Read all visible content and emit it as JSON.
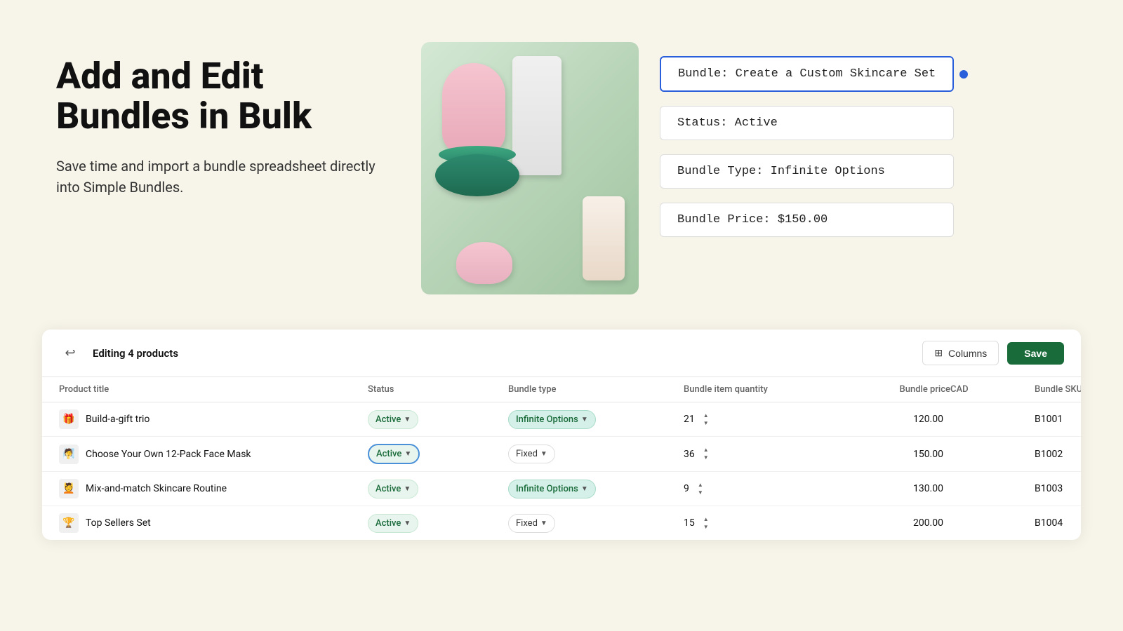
{
  "hero": {
    "title": "Add and Edit Bundles in Bulk",
    "subtitle": "Save time and import a bundle spreadsheet directly into Simple Bundles."
  },
  "info_cards": [
    {
      "id": "bundle-name",
      "label": "Bundle: Create a Custom Skincare Set",
      "highlighted": true
    },
    {
      "id": "status",
      "label": "Status: Active",
      "highlighted": false
    },
    {
      "id": "bundle-type",
      "label": "Bundle Type: Infinite Options",
      "highlighted": false
    },
    {
      "id": "bundle-price",
      "label": "Bundle Price: $150.00",
      "highlighted": false
    }
  ],
  "panel": {
    "editing_label": "Editing 4 products",
    "columns_button": "Columns",
    "save_button": "Save"
  },
  "table": {
    "headers": [
      "Product title",
      "Status",
      "Bundle type",
      "Bundle item quantity",
      "Bundle price",
      "CAD",
      "Bundle SKU"
    ],
    "rows": [
      {
        "id": "row-1",
        "icon": "🎁",
        "title": "Build-a-gift trio",
        "status": "Active",
        "status_highlighted": false,
        "bundle_type": "Infinite Options",
        "bundle_type_variant": "badge",
        "quantity": 21,
        "price": "120.00",
        "sku": "B1001"
      },
      {
        "id": "row-2",
        "icon": "🧖",
        "title": "Choose Your Own 12-Pack Face Mask",
        "status": "Active",
        "status_highlighted": true,
        "bundle_type": "Fixed",
        "bundle_type_variant": "plain",
        "quantity": 36,
        "price": "150.00",
        "sku": "B1002"
      },
      {
        "id": "row-3",
        "icon": "💆",
        "title": "Mix-and-match Skincare Routine",
        "status": "Active",
        "status_highlighted": false,
        "bundle_type": "Infinite Options",
        "bundle_type_variant": "badge",
        "quantity": 9,
        "price": "130.00",
        "sku": "B1003"
      },
      {
        "id": "row-4",
        "icon": "🏆",
        "title": "Top Sellers Set",
        "status": "Active",
        "status_highlighted": false,
        "bundle_type": "Fixed",
        "bundle_type_variant": "plain",
        "quantity": 15,
        "price": "200.00",
        "sku": "B1004"
      }
    ]
  }
}
